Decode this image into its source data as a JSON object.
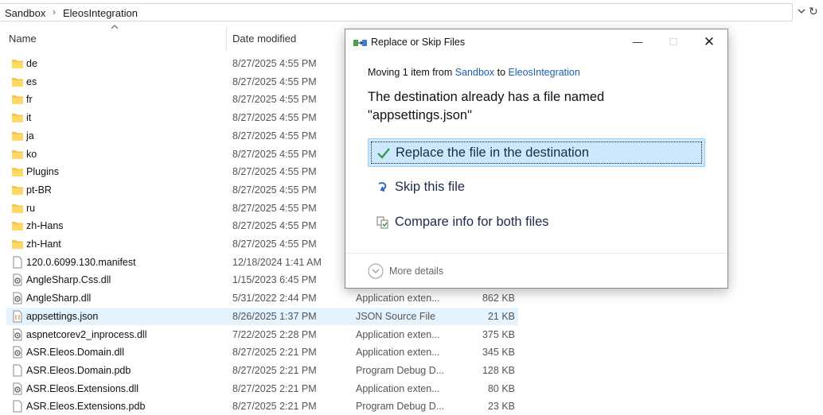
{
  "address": {
    "crumbs": [
      "Sandbox",
      "EleosIntegration"
    ],
    "separator": "›"
  },
  "columns": {
    "name": "Name",
    "date_modified": "Date modified"
  },
  "files": [
    {
      "name": "de",
      "date": "8/27/2025 4:55 PM",
      "type": "",
      "size": "",
      "icon": "folder-icon",
      "selected": false
    },
    {
      "name": "es",
      "date": "8/27/2025 4:55 PM",
      "type": "",
      "size": "",
      "icon": "folder-icon",
      "selected": false
    },
    {
      "name": "fr",
      "date": "8/27/2025 4:55 PM",
      "type": "",
      "size": "",
      "icon": "folder-icon",
      "selected": false
    },
    {
      "name": "it",
      "date": "8/27/2025 4:55 PM",
      "type": "",
      "size": "",
      "icon": "folder-icon",
      "selected": false
    },
    {
      "name": "ja",
      "date": "8/27/2025 4:55 PM",
      "type": "",
      "size": "",
      "icon": "folder-icon",
      "selected": false
    },
    {
      "name": "ko",
      "date": "8/27/2025 4:55 PM",
      "type": "",
      "size": "",
      "icon": "folder-icon",
      "selected": false
    },
    {
      "name": "Plugins",
      "date": "8/27/2025 4:55 PM",
      "type": "",
      "size": "",
      "icon": "folder-icon",
      "selected": false
    },
    {
      "name": "pt-BR",
      "date": "8/27/2025 4:55 PM",
      "type": "",
      "size": "",
      "icon": "folder-icon",
      "selected": false
    },
    {
      "name": "ru",
      "date": "8/27/2025 4:55 PM",
      "type": "",
      "size": "",
      "icon": "folder-icon",
      "selected": false
    },
    {
      "name": "zh-Hans",
      "date": "8/27/2025 4:55 PM",
      "type": "",
      "size": "",
      "icon": "folder-icon",
      "selected": false
    },
    {
      "name": "zh-Hant",
      "date": "8/27/2025 4:55 PM",
      "type": "",
      "size": "",
      "icon": "folder-icon",
      "selected": false
    },
    {
      "name": "120.0.6099.130.manifest",
      "date": "12/18/2024 1:41 AM",
      "type": "",
      "size": "",
      "icon": "file-icon",
      "selected": false
    },
    {
      "name": "AngleSharp.Css.dll",
      "date": "1/15/2023 6:45 PM",
      "type": "",
      "size": "",
      "icon": "dll-icon",
      "selected": false
    },
    {
      "name": "AngleSharp.dll",
      "date": "5/31/2022 2:44 PM",
      "type": "Application exten...",
      "size": "862 KB",
      "icon": "dll-icon",
      "selected": false
    },
    {
      "name": "appsettings.json",
      "date": "8/26/2025 1:37 PM",
      "type": "JSON Source File",
      "size": "21 KB",
      "icon": "json-file-icon",
      "selected": true
    },
    {
      "name": "aspnetcorev2_inprocess.dll",
      "date": "7/22/2025 2:28 PM",
      "type": "Application exten...",
      "size": "375 KB",
      "icon": "dll-icon",
      "selected": false
    },
    {
      "name": "ASR.Eleos.Domain.dll",
      "date": "8/27/2025 2:21 PM",
      "type": "Application exten...",
      "size": "345 KB",
      "icon": "dll-icon",
      "selected": false
    },
    {
      "name": "ASR.Eleos.Domain.pdb",
      "date": "8/27/2025 2:21 PM",
      "type": "Program Debug D...",
      "size": "128 KB",
      "icon": "file-icon",
      "selected": false
    },
    {
      "name": "ASR.Eleos.Extensions.dll",
      "date": "8/27/2025 2:21 PM",
      "type": "Application exten...",
      "size": "80 KB",
      "icon": "dll-icon",
      "selected": false
    },
    {
      "name": "ASR.Eleos.Extensions.pdb",
      "date": "8/27/2025 2:21 PM",
      "type": "Program Debug D...",
      "size": "23 KB",
      "icon": "file-icon",
      "selected": false
    }
  ],
  "dialog": {
    "title": "Replace or Skip Files",
    "moving_prefix": "Moving 1 item from ",
    "source": "Sandbox",
    "to_word": " to ",
    "destination": "EleosIntegration",
    "message": "The destination already has a file named \"appsettings.json\"",
    "options": [
      {
        "label": "Replace the file in the destination",
        "icon": "check-icon"
      },
      {
        "label": "Skip this file",
        "icon": "skip-icon"
      },
      {
        "label": "Compare info for both files",
        "icon": "compare-icon"
      }
    ],
    "more_details": "More details",
    "controls": {
      "minimize": "—",
      "maximize": "☐",
      "close": "✕"
    }
  },
  "colors": {
    "folder": "#f4c54a",
    "link": "#1a5fb4",
    "selection": "#e5f3ff",
    "primary_option": "#cce8ff",
    "check": "#2e9a3c"
  }
}
